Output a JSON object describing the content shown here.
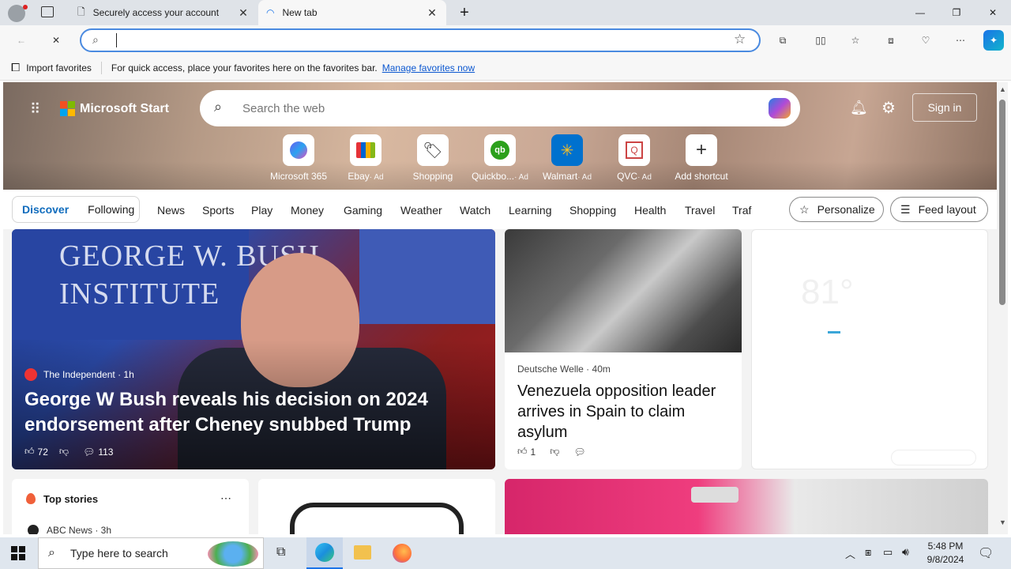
{
  "browser": {
    "tabs": [
      {
        "title": "Securely access your account"
      },
      {
        "title": "New tab"
      }
    ],
    "address": {
      "value": ""
    },
    "favorites_bar": {
      "import_label": "Import favorites",
      "message": "For quick access, place your favorites here on the favorites bar.",
      "manage_link": "Manage favorites now"
    }
  },
  "page": {
    "brand": "Microsoft Start",
    "search_placeholder": "Search the web",
    "sign_in": "Sign in",
    "shortcuts": [
      {
        "label": "Microsoft 365",
        "ad": ""
      },
      {
        "label": "Ebay",
        "ad": "· Ad"
      },
      {
        "label": "Shopping",
        "ad": ""
      },
      {
        "label": "Quickbo...",
        "ad": "· Ad"
      },
      {
        "label": "Walmart",
        "ad": "· Ad"
      },
      {
        "label": "QVC",
        "ad": "· Ad"
      },
      {
        "label": "Add shortcut",
        "ad": ""
      }
    ],
    "tabs": [
      "Discover",
      "Following"
    ],
    "nav": [
      "News",
      "Sports",
      "Play",
      "Money",
      "Gaming",
      "Weather",
      "Watch",
      "Learning",
      "Shopping",
      "Health",
      "Travel",
      "Traf"
    ],
    "personalize": "Personalize",
    "feed_layout": "Feed layout",
    "hero_story": {
      "source": "The Independent · 1h",
      "title": "George W Bush reveals his decision on 2024 endorsement after Cheney snubbed Trump",
      "likes": "72",
      "comments": "113",
      "watermark_lines": [
        "GEORGE W. BUSH",
        "INSTITUTE"
      ]
    },
    "story2": {
      "source": "Deutsche Welle",
      "time": "40m",
      "title": "Venezuela opposition leader arrives in Spain to claim asylum",
      "likes": "1"
    },
    "weather_temp": "81°",
    "top_stories": {
      "label": "Top stories",
      "source": "ABC News · 3h"
    }
  },
  "taskbar": {
    "search_placeholder": "Type here to search",
    "time": "5:48 PM",
    "date": "9/8/2024"
  },
  "colors": {
    "accent": "#0b57d0",
    "discover": "#0f6cbd"
  }
}
